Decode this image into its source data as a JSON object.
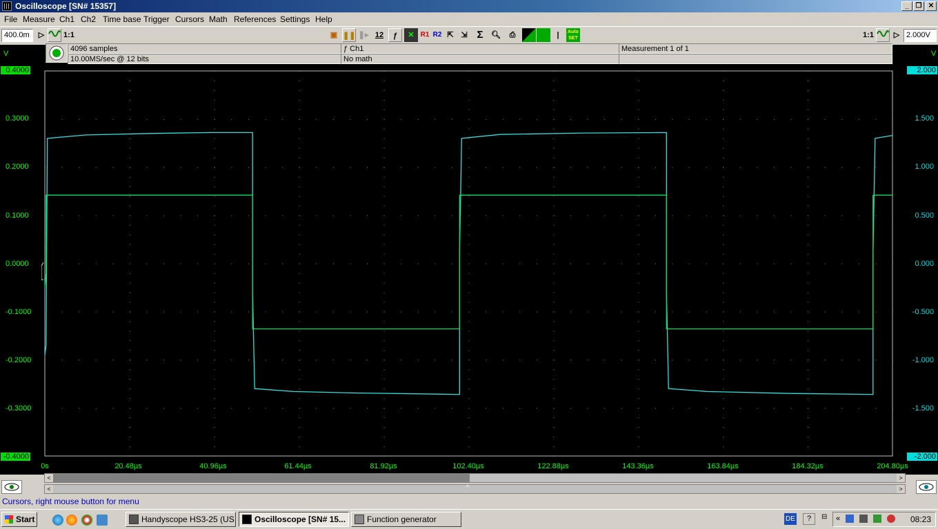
{
  "window": {
    "title": "Oscilloscope  [SN# 15357]"
  },
  "menu": [
    "File",
    "Measure",
    "Ch1",
    "Ch2",
    "Time base",
    "Trigger",
    "Cursors",
    "Math",
    "References",
    "Settings",
    "Help"
  ],
  "toolbar": {
    "ch1_range": "400.0m",
    "ch2_range": "2.000V",
    "ratio_left": "1:1",
    "ratio_right": "1:1",
    "btn_12": "12",
    "btn_f": "ƒ",
    "btn_r1": "R1",
    "btn_r2": "R2",
    "btn_sigma": "Σ",
    "btn_bar": "|",
    "btn_auto": "Auto SET"
  },
  "info": {
    "samples": "4096 samples",
    "rate": "10.00MS/sec @ 12 bits",
    "ch": "ƒ Ch1",
    "math": "No math",
    "measurement": "Measurement 1 of 1"
  },
  "units": {
    "left": "V",
    "right": "V"
  },
  "left_axis": [
    "0.4000",
    "0.3000",
    "0.2000",
    "0.1000",
    "0.0000",
    "-0.1000",
    "-0.2000",
    "-0.3000",
    "-0.4000"
  ],
  "right_axis": [
    "2.000",
    "1.500",
    "1.000",
    "0.500",
    "0.000",
    "-0.500",
    "-1.000",
    "-1.500",
    "-2.000"
  ],
  "x_axis": [
    "0s",
    "20.48µs",
    "40.96µs",
    "61.44µs",
    "81.92µs",
    "102.40µs",
    "122.88µs",
    "143.36µs",
    "163.84µs",
    "184.32µs",
    "204.80µs"
  ],
  "chart_data": {
    "type": "line",
    "x_range_us": [
      0,
      204.8
    ],
    "ch1_ylim_V": [
      -0.4,
      0.4
    ],
    "ch2_ylim_V": [
      -2.0,
      2.0
    ],
    "colors": {
      "ch1": "#00e060",
      "ch2": "#30e0e0",
      "grid": "#808080"
    },
    "series": [
      {
        "x": [
          0,
          0.3,
          0.3,
          50.2,
          50.2,
          100.2,
          100.2,
          150.2,
          150.2,
          200.1,
          200.1,
          204.8
        ],
        "y": [
          -0.05,
          -0.02,
          0.142,
          0.142,
          -0.136,
          -0.136,
          0.142,
          0.142,
          -0.136,
          -0.136,
          0.142,
          0.142
        ]
      },
      {
        "x": [
          0,
          0.3,
          0.6,
          10,
          25,
          40,
          50.2,
          50.2,
          50.7,
          60,
          75,
          100.2,
          100.2,
          100.7,
          110,
          130,
          150.2,
          150.2,
          150.7,
          160,
          180,
          200.1,
          200.1,
          200.6,
          204.8
        ],
        "y": [
          -0.95,
          -0.85,
          1.3,
          1.335,
          1.35,
          1.36,
          1.36,
          -0.28,
          -1.3,
          -1.33,
          -1.345,
          -1.36,
          0.1,
          1.3,
          1.34,
          1.355,
          1.36,
          -0.28,
          -1.3,
          -1.33,
          -1.35,
          -1.36,
          0.1,
          1.3,
          1.33
        ]
      }
    ]
  },
  "status": "Cursors, right mouse button for menu",
  "taskbar": {
    "start": "Start",
    "tasks": [
      "Handyscope HS3-25 (US...",
      "Oscilloscope  [SN# 15...",
      "Function generator"
    ],
    "lang": "DE",
    "help": "?",
    "clock": "08:23"
  }
}
